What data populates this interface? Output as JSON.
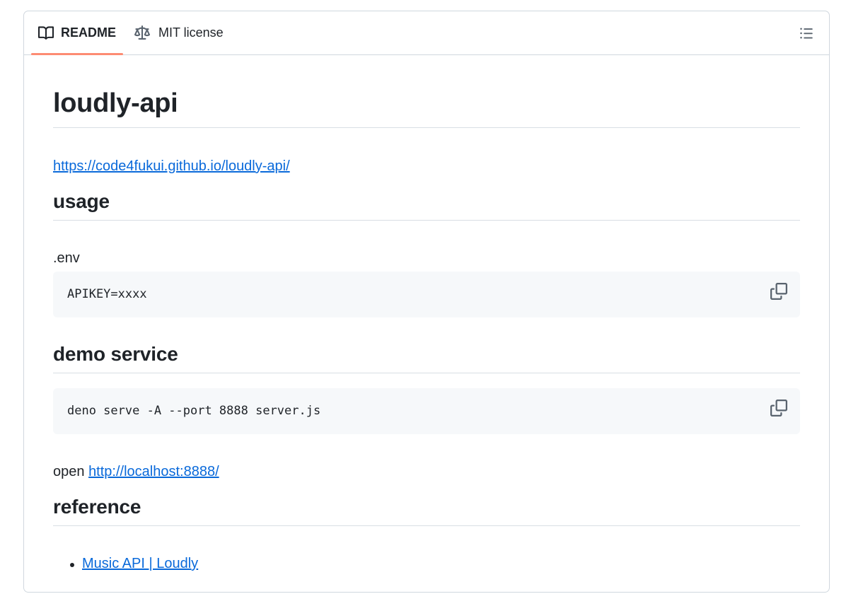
{
  "tabs": {
    "readme": "README",
    "license": "MIT license"
  },
  "readme": {
    "title": "loudly-api",
    "site_link": "https://code4fukui.github.io/loudly-api/",
    "sections": {
      "usage": {
        "heading": "usage",
        "file_label": ".env",
        "code": "APIKEY=xxxx"
      },
      "demo": {
        "heading": "demo service",
        "code": "deno serve -A --port 8888 server.js",
        "open_prefix": "open",
        "open_link": "http://localhost:8888/"
      },
      "reference": {
        "heading": "reference",
        "items": [
          "Music API | Loudly"
        ]
      }
    }
  },
  "colors": {
    "link": "#0969da",
    "tab_underline": "#fd8c73",
    "code_bg": "#f6f8fa",
    "border": "#d0d7de"
  },
  "icons": {
    "readme_tab": "book-icon",
    "license_tab": "scale-icon",
    "outline": "list-unordered-icon",
    "copy": "copy-icon"
  }
}
